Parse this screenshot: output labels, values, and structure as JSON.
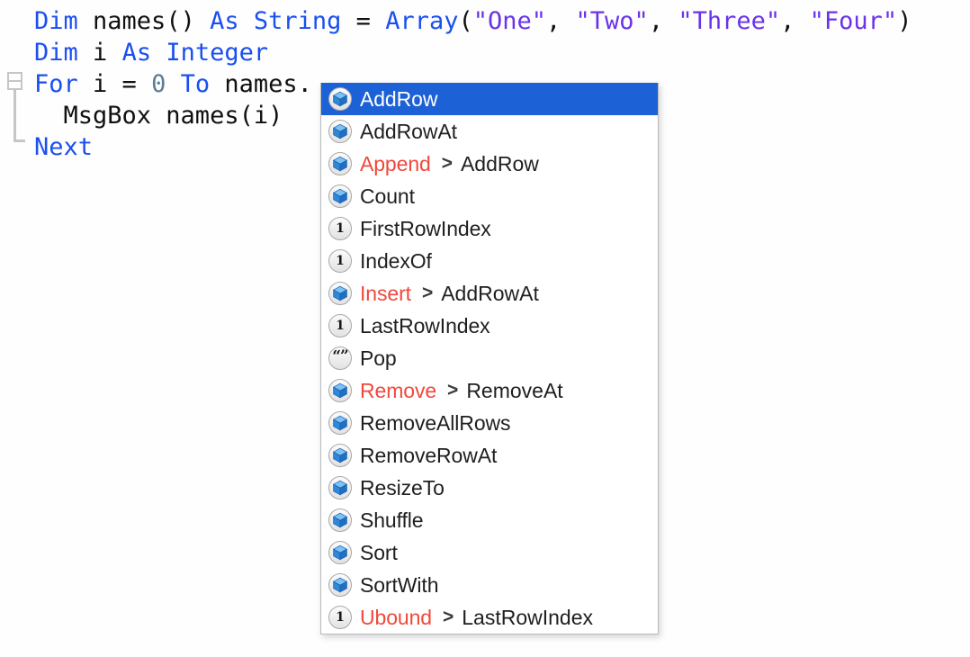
{
  "editor": {
    "background_color": "#fefefe",
    "syntax_colors": {
      "keyword": "#1a4ff0",
      "string": "#6a33ea",
      "number": "#5d7c96",
      "plain": "#101010"
    },
    "gutter": {
      "fold_widget": "collapse-minus-box"
    },
    "lines": [
      {
        "id": "line-1",
        "tokens": [
          {
            "t": "Dim",
            "c": "kw"
          },
          {
            "t": " names() ",
            "c": "pln"
          },
          {
            "t": "As String",
            "c": "kw"
          },
          {
            "t": " = ",
            "c": "pln"
          },
          {
            "t": "Array",
            "c": "kw"
          },
          {
            "t": "(",
            "c": "pln"
          },
          {
            "t": "\"One\"",
            "c": "str"
          },
          {
            "t": ", ",
            "c": "pln"
          },
          {
            "t": "\"Two\"",
            "c": "str"
          },
          {
            "t": ", ",
            "c": "pln"
          },
          {
            "t": "\"Three\"",
            "c": "str"
          },
          {
            "t": ", ",
            "c": "pln"
          },
          {
            "t": "\"Four\"",
            "c": "str"
          },
          {
            "t": ")",
            "c": "pln"
          }
        ]
      },
      {
        "id": "line-2",
        "tokens": [
          {
            "t": "Dim",
            "c": "kw"
          },
          {
            "t": " i ",
            "c": "pln"
          },
          {
            "t": "As Integer",
            "c": "kw"
          }
        ]
      },
      {
        "id": "line-3",
        "tokens": [
          {
            "t": "For",
            "c": "kw"
          },
          {
            "t": " i = ",
            "c": "pln"
          },
          {
            "t": "0",
            "c": "num"
          },
          {
            "t": " ",
            "c": "pln"
          },
          {
            "t": "To",
            "c": "kw"
          },
          {
            "t": " names.",
            "c": "pln"
          }
        ]
      },
      {
        "id": "line-4",
        "tokens": [
          {
            "t": "  MsgBox names(i)",
            "c": "pln"
          }
        ]
      },
      {
        "id": "line-5",
        "tokens": [
          {
            "t": "Next",
            "c": "kw"
          }
        ]
      }
    ]
  },
  "autocomplete": {
    "selected_index": 0,
    "selection_color": "#1d61d6",
    "deprecated_color": "#f0483c",
    "arrow_glyph": ">",
    "items": [
      {
        "label": "AddRow",
        "icon": "cube-icon",
        "deprecated": false,
        "replacement": ""
      },
      {
        "label": "AddRowAt",
        "icon": "cube-icon",
        "deprecated": false,
        "replacement": ""
      },
      {
        "label": "Append",
        "icon": "cube-icon",
        "deprecated": true,
        "replacement": "AddRow"
      },
      {
        "label": "Count",
        "icon": "cube-icon",
        "deprecated": false,
        "replacement": ""
      },
      {
        "label": "FirstRowIndex",
        "icon": "integer-icon",
        "deprecated": false,
        "replacement": ""
      },
      {
        "label": "IndexOf",
        "icon": "integer-icon",
        "deprecated": false,
        "replacement": ""
      },
      {
        "label": "Insert",
        "icon": "cube-icon",
        "deprecated": true,
        "replacement": "AddRowAt"
      },
      {
        "label": "LastRowIndex",
        "icon": "integer-icon",
        "deprecated": false,
        "replacement": ""
      },
      {
        "label": "Pop",
        "icon": "string-icon",
        "deprecated": false,
        "replacement": ""
      },
      {
        "label": "Remove",
        "icon": "cube-icon",
        "deprecated": true,
        "replacement": "RemoveAt"
      },
      {
        "label": "RemoveAllRows",
        "icon": "cube-icon",
        "deprecated": false,
        "replacement": ""
      },
      {
        "label": "RemoveRowAt",
        "icon": "cube-icon",
        "deprecated": false,
        "replacement": ""
      },
      {
        "label": "ResizeTo",
        "icon": "cube-icon",
        "deprecated": false,
        "replacement": ""
      },
      {
        "label": "Shuffle",
        "icon": "cube-icon",
        "deprecated": false,
        "replacement": ""
      },
      {
        "label": "Sort",
        "icon": "cube-icon",
        "deprecated": false,
        "replacement": ""
      },
      {
        "label": "SortWith",
        "icon": "cube-icon",
        "deprecated": false,
        "replacement": ""
      },
      {
        "label": "Ubound",
        "icon": "integer-icon",
        "deprecated": true,
        "replacement": "LastRowIndex"
      }
    ],
    "icon_glyphs": {
      "integer-icon": "1",
      "string-icon": "“”"
    }
  }
}
